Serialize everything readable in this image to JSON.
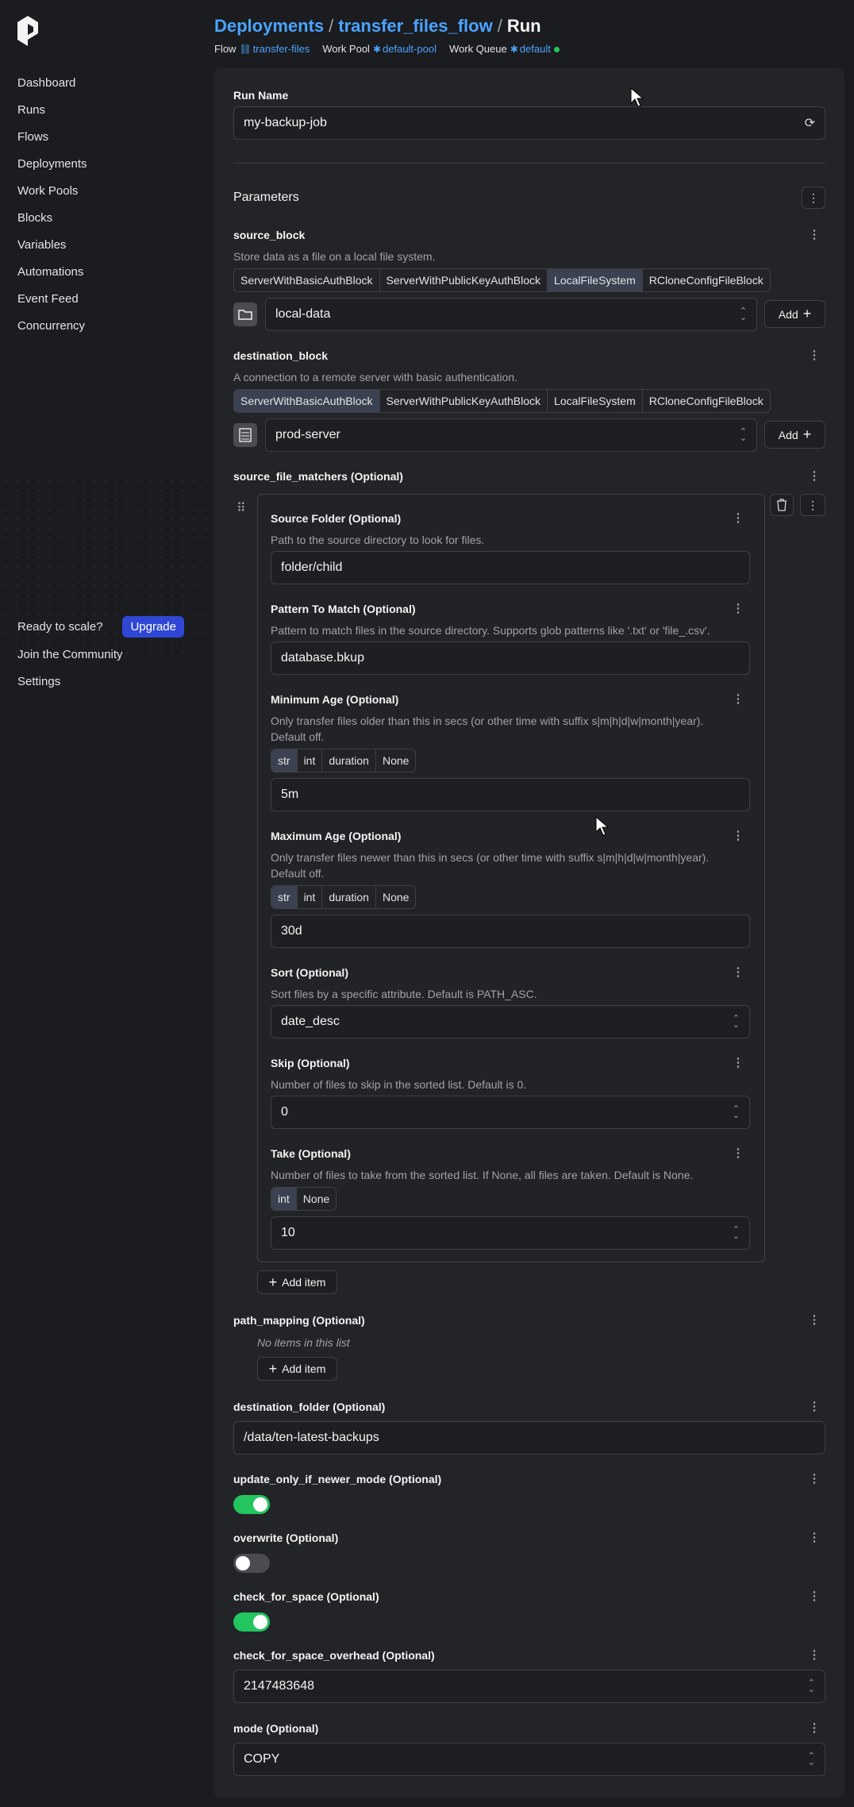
{
  "sidebar": {
    "nav": [
      "Dashboard",
      "Runs",
      "Flows",
      "Deployments",
      "Work Pools",
      "Blocks",
      "Variables",
      "Automations",
      "Event Feed",
      "Concurrency"
    ],
    "ready_text": "Ready to scale?",
    "upgrade_label": "Upgrade",
    "community_label": "Join the Community",
    "settings_label": "Settings"
  },
  "header": {
    "crumb_deployments": "Deployments",
    "crumb_flow": "transfer_files_flow",
    "crumb_current": "Run",
    "sep": "/",
    "flow_label": "Flow",
    "flow_value": "transfer-files",
    "pool_label": "Work Pool",
    "pool_value": "default-pool",
    "queue_label": "Work Queue",
    "queue_value": "default"
  },
  "run_name": {
    "label": "Run Name",
    "value": "my-backup-job"
  },
  "parameters_title": "Parameters",
  "source_block": {
    "label": "source_block",
    "desc": "Store data as a file on a local file system.",
    "tabs": [
      "ServerWithBasicAuthBlock",
      "ServerWithPublicKeyAuthBlock",
      "LocalFileSystem",
      "RCloneConfigFileBlock"
    ],
    "active_tab": 2,
    "value": "local-data",
    "add_label": "Add"
  },
  "destination_block": {
    "label": "destination_block",
    "desc": "A connection to a remote server with basic authentication.",
    "tabs": [
      "ServerWithBasicAuthBlock",
      "ServerWithPublicKeyAuthBlock",
      "LocalFileSystem",
      "RCloneConfigFileBlock"
    ],
    "active_tab": 0,
    "value": "prod-server",
    "add_label": "Add"
  },
  "source_file_matchers": {
    "label": "source_file_matchers (Optional)",
    "source_folder": {
      "label": "Source Folder (Optional)",
      "desc": "Path to the source directory to look for files.",
      "value": "folder/child"
    },
    "pattern": {
      "label": "Pattern To Match (Optional)",
      "desc": "Pattern to match files in the source directory. Supports glob patterns like '.txt' or 'file_.csv'.",
      "value": "database.bkup"
    },
    "min_age": {
      "label": "Minimum Age (Optional)",
      "desc1": "Only transfer files older than this in secs (or other time with suffix s|m|h|d|w|month|year).",
      "desc2": "Default off.",
      "types": [
        "str",
        "int",
        "duration",
        "None"
      ],
      "value": "5m"
    },
    "max_age": {
      "label": "Maximum Age (Optional)",
      "desc1": "Only transfer files newer than this in secs (or other time with suffix s|m|h|d|w|month|year).",
      "desc2": "Default off.",
      "types": [
        "str",
        "int",
        "duration",
        "None"
      ],
      "value": "30d"
    },
    "sort": {
      "label": "Sort (Optional)",
      "desc": "Sort files by a specific attribute. Default is PATH_ASC.",
      "value": "date_desc"
    },
    "skip": {
      "label": "Skip (Optional)",
      "desc": "Number of files to skip in the sorted list. Default is 0.",
      "value": "0"
    },
    "take": {
      "label": "Take (Optional)",
      "desc": "Number of files to take from the sorted list. If None, all files are taken. Default is None.",
      "types": [
        "int",
        "None"
      ],
      "value": "10"
    },
    "add_item_label": "Add item"
  },
  "path_mapping": {
    "label": "path_mapping (Optional)",
    "empty": "No items in this list",
    "add_item_label": "Add item"
  },
  "destination_folder": {
    "label": "destination_folder (Optional)",
    "value": "/data/ten-latest-backups"
  },
  "update_only_if_newer_mode": {
    "label": "update_only_if_newer_mode (Optional)",
    "on": true
  },
  "overwrite": {
    "label": "overwrite (Optional)",
    "on": false
  },
  "check_for_space": {
    "label": "check_for_space (Optional)",
    "on": true
  },
  "check_for_space_overhead": {
    "label": "check_for_space_overhead (Optional)",
    "value": "2147483648"
  },
  "mode": {
    "label": "mode (Optional)",
    "value": "COPY"
  },
  "colors": {
    "accent": "#4aa3ff",
    "toggle_on": "#22c55e",
    "toggle_off": "#4b4c52",
    "upgrade": "#2f47d4"
  }
}
